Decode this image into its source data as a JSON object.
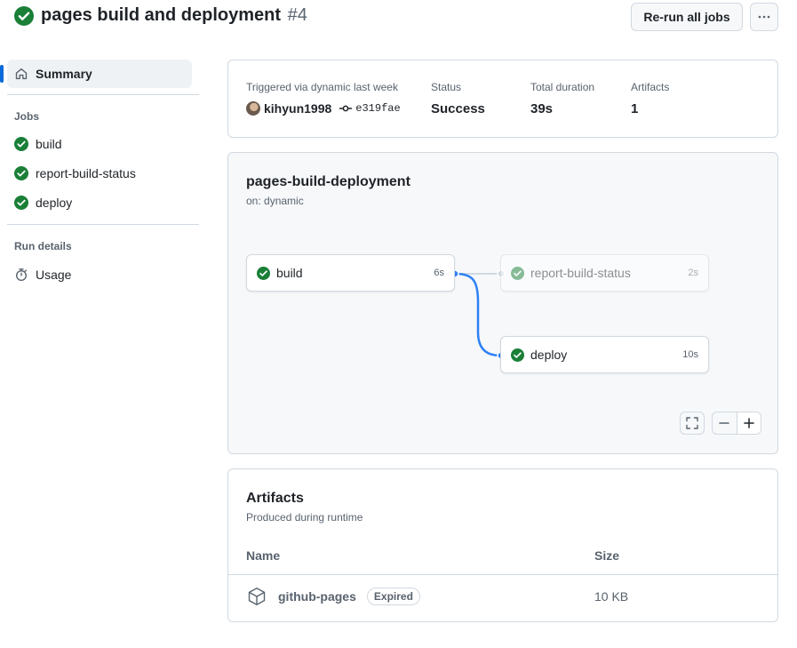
{
  "header": {
    "title": "pages build and deployment",
    "run_number": "#4",
    "rerun_label": "Re-run all jobs",
    "more_label": "···"
  },
  "sidebar": {
    "summary_label": "Summary",
    "jobs_heading": "Jobs",
    "jobs": [
      {
        "label": "build"
      },
      {
        "label": "report-build-status"
      },
      {
        "label": "deploy"
      }
    ],
    "run_details_heading": "Run details",
    "usage_label": "Usage"
  },
  "summary": {
    "triggered_label": "Triggered via dynamic last week",
    "actor": "kihyun1998",
    "commit": "e319fae",
    "status_label": "Status",
    "status_value": "Success",
    "duration_label": "Total duration",
    "duration_value": "39s",
    "artifacts_label": "Artifacts",
    "artifacts_value": "1"
  },
  "graph": {
    "title": "pages-build-deployment",
    "subtitle": "on: dynamic",
    "jobs": [
      {
        "name": "build",
        "duration": "6s"
      },
      {
        "name": "report-build-status",
        "duration": "2s"
      },
      {
        "name": "deploy",
        "duration": "10s"
      }
    ]
  },
  "artifacts": {
    "title": "Artifacts",
    "subtitle": "Produced during runtime",
    "col_name": "Name",
    "col_size": "Size",
    "rows": [
      {
        "name": "github-pages",
        "badge": "Expired",
        "size": "10 KB"
      }
    ]
  },
  "colors": {
    "success": "#1a7f37",
    "accent": "#0969da",
    "graph_edge": "#2f81f7"
  }
}
